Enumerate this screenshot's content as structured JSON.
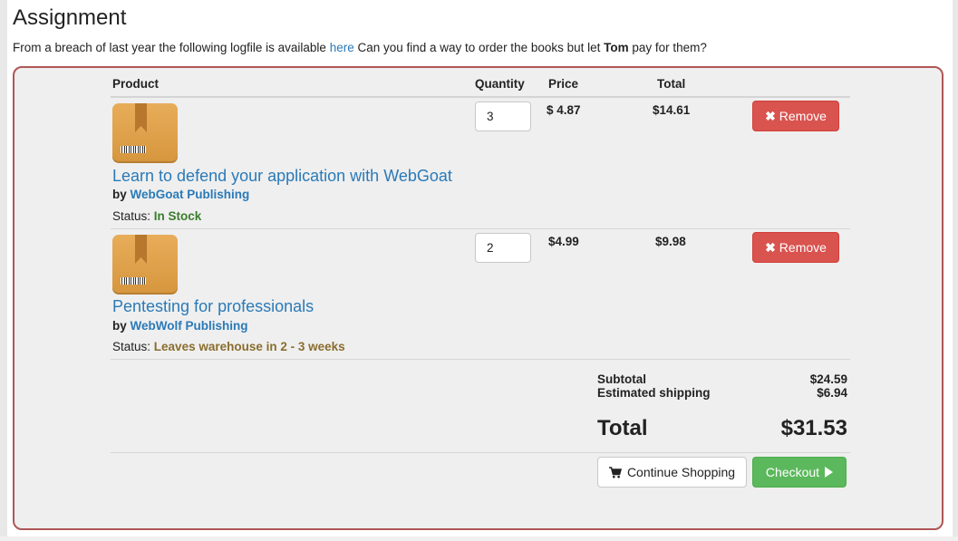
{
  "page": {
    "title": "Assignment",
    "intro_before": "From a breach of last year the following logfile is available ",
    "intro_link": "here",
    "intro_middle": " Can you find a way to order the books but let ",
    "intro_bold": "Tom",
    "intro_after": " pay for them?"
  },
  "table": {
    "headers": {
      "product": "Product",
      "quantity": "Quantity",
      "price": "Price",
      "total": "Total"
    }
  },
  "items": [
    {
      "title": "Learn to defend your application with WebGoat",
      "by": "by",
      "publisher": "WebGoat Publishing",
      "status_label": "Status:",
      "status": "In Stock",
      "quantity": "3",
      "price": "$ 4.87",
      "total": "$14.61",
      "remove_label": "Remove"
    },
    {
      "title": "Pentesting for professionals",
      "by": "by",
      "publisher": "WebWolf Publishing",
      "status_label": "Status:",
      "status": "Leaves warehouse in 2 - 3 weeks",
      "quantity": "2",
      "price": "$4.99",
      "total": "$9.98",
      "remove_label": "Remove"
    }
  ],
  "summary": {
    "subtotal_label": "Subtotal",
    "subtotal": "$24.59",
    "shipping_label": "Estimated shipping",
    "shipping": "$6.94",
    "total_label": "Total",
    "total": "$31.53"
  },
  "actions": {
    "continue_label": "Continue Shopping",
    "checkout_label": "Checkout"
  },
  "icons": {
    "remove": "x-icon",
    "cart": "shopping-cart-icon",
    "checkout": "play-icon",
    "product": "package-box-icon"
  },
  "colors": {
    "link": "#2a7ab8",
    "remove_button": "#d9534f",
    "checkout_button": "#5cb85c",
    "panel_border": "#b05757",
    "in_stock": "#3a7d2c",
    "delayed": "#8a6d2e"
  }
}
